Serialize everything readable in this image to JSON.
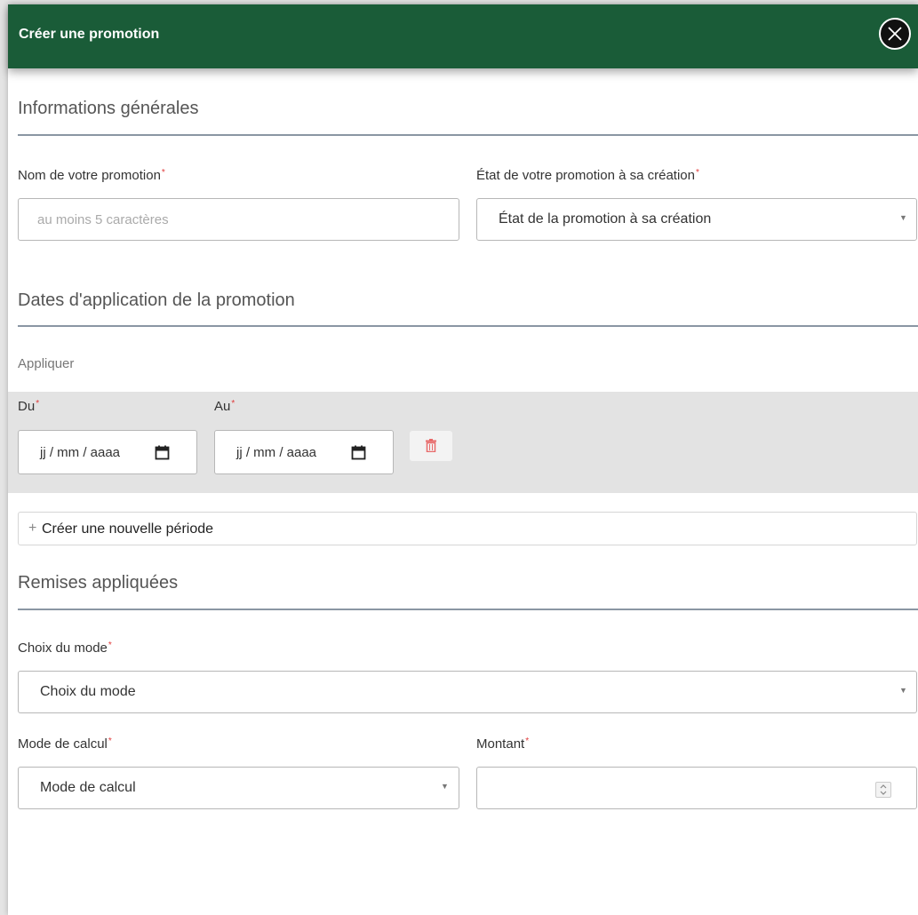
{
  "modal": {
    "title": "Créer une promotion",
    "close_icon": "close-icon"
  },
  "general": {
    "section_title": "Informations générales",
    "name_label": "Nom de votre promotion",
    "name_placeholder": "au moins 5 caractères",
    "name_value": "",
    "state_label": "État de votre promotion à sa création",
    "state_selected": "État de la promotion à sa création"
  },
  "dates": {
    "section_title": "Dates d'application de la promotion",
    "apply_label": "Appliquer",
    "from_label": "Du",
    "to_label": "Au",
    "from_value": "jj / mm / aaaa",
    "to_value": "jj / mm / aaaa",
    "new_period_label": "Créer une nouvelle période"
  },
  "discounts": {
    "section_title": "Remises appliquées",
    "mode_label": "Choix du mode",
    "mode_selected": "Choix du mode",
    "calc_label": "Mode de calcul",
    "calc_selected": "Mode de calcul",
    "amount_label": "Montant",
    "amount_value": ""
  },
  "required_marker": "*",
  "colors": {
    "header_bg": "#1a5c38",
    "required": "#e03a3a",
    "trash": "#e86a6a"
  }
}
